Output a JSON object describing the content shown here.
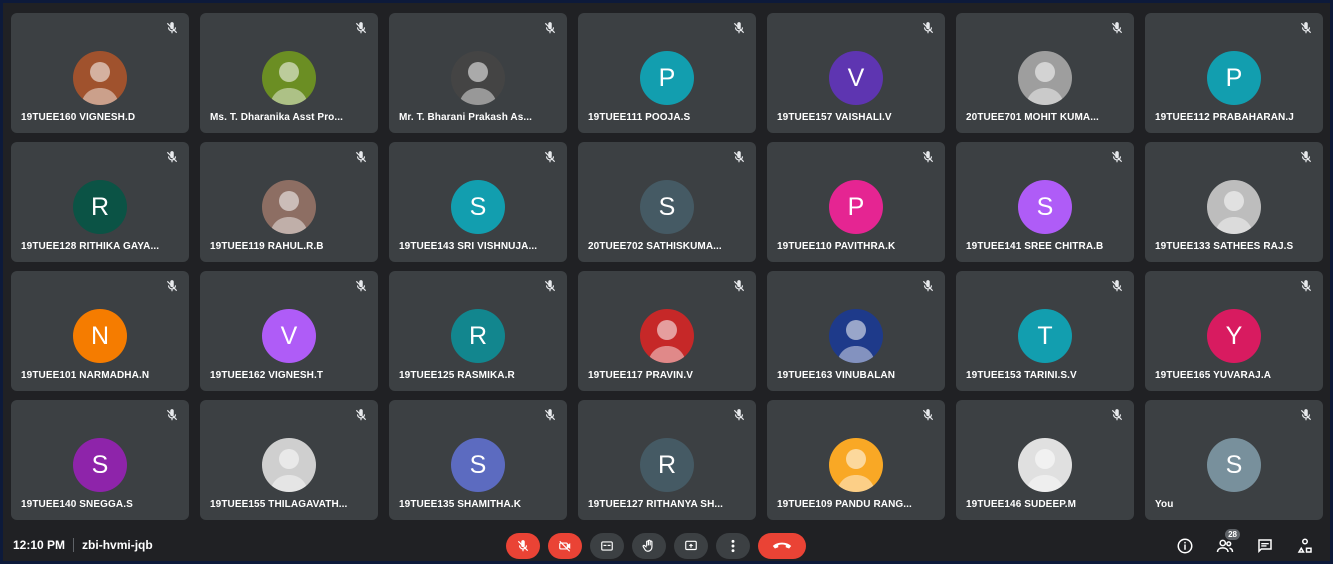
{
  "participants": [
    {
      "name": "19TUEE160 VIGNESH.D",
      "initial": "",
      "color": "#a0522d",
      "photo": true
    },
    {
      "name": "Ms. T. Dharanika Asst Pro...",
      "initial": "",
      "color": "#6b8e23",
      "photo": true
    },
    {
      "name": "Mr. T. Bharani Prakash As...",
      "initial": "",
      "color": "#444444",
      "photo": true
    },
    {
      "name": "19TUEE111 POOJA.S",
      "initial": "P",
      "color": "#129eaf",
      "photo": false
    },
    {
      "name": "19TUEE157 VAISHALI.V",
      "initial": "V",
      "color": "#5e35b1",
      "photo": false
    },
    {
      "name": "20TUEE701 MOHIT KUMA...",
      "initial": "",
      "color": "#9e9e9e",
      "photo": true
    },
    {
      "name": "19TUEE112 PRABAHARAN.J",
      "initial": "P",
      "color": "#129eaf",
      "photo": false
    },
    {
      "name": "19TUEE128 RITHIKA GAYA...",
      "initial": "R",
      "color": "#0b5345",
      "photo": false
    },
    {
      "name": "19TUEE119 RAHUL.R.B",
      "initial": "",
      "color": "#8d6e63",
      "photo": true
    },
    {
      "name": "19TUEE143 SRI VISHNUJA...",
      "initial": "S",
      "color": "#129eaf",
      "photo": false
    },
    {
      "name": "20TUEE702 SATHISKUMA...",
      "initial": "S",
      "color": "#455a64",
      "photo": false
    },
    {
      "name": "19TUEE110 PAVITHRA.K",
      "initial": "P",
      "color": "#e52592",
      "photo": false
    },
    {
      "name": "19TUEE141 SREE CHITRA.B",
      "initial": "S",
      "color": "#af5cf7",
      "photo": false
    },
    {
      "name": "19TUEE133 SATHEES RAJ.S",
      "initial": "",
      "color": "#bdbdbd",
      "photo": true
    },
    {
      "name": "19TUEE101 NARMADHA.N",
      "initial": "N",
      "color": "#f57c00",
      "photo": false
    },
    {
      "name": "19TUEE162 VIGNESH.T",
      "initial": "V",
      "color": "#af5cf7",
      "photo": false
    },
    {
      "name": "19TUEE125 RASMIKA.R",
      "initial": "R",
      "color": "#12868e",
      "photo": false
    },
    {
      "name": "19TUEE117 PRAVIN.V",
      "initial": "",
      "color": "#c62828",
      "photo": true
    },
    {
      "name": "19TUEE163 VINUBALAN",
      "initial": "",
      "color": "#1e3a8a",
      "photo": true
    },
    {
      "name": "19TUEE153 TARINI.S.V",
      "initial": "T",
      "color": "#129eaf",
      "photo": false
    },
    {
      "name": "19TUEE165 YUVARAJ.A",
      "initial": "Y",
      "color": "#d81b60",
      "photo": false
    },
    {
      "name": "19TUEE140 SNEGGA.S",
      "initial": "S",
      "color": "#8e24aa",
      "photo": false
    },
    {
      "name": "19TUEE155 THILAGAVATH...",
      "initial": "",
      "color": "#cfcfcf",
      "photo": true
    },
    {
      "name": "19TUEE135 SHAMITHA.K",
      "initial": "S",
      "color": "#5c6bc0",
      "photo": false
    },
    {
      "name": "19TUEE127 RITHANYA SH...",
      "initial": "R",
      "color": "#455a64",
      "photo": false
    },
    {
      "name": "19TUEE109 PANDU RANG...",
      "initial": "",
      "color": "#f9a825",
      "photo": true
    },
    {
      "name": "19TUEE146 SUDEEP.M",
      "initial": "",
      "color": "#e0e0e0",
      "photo": true
    },
    {
      "name": "You",
      "initial": "S",
      "color": "#78909c",
      "photo": false
    }
  ],
  "meeting": {
    "time": "12:10 PM",
    "code": "zbi-hvmi-jqb"
  },
  "people_count": "28",
  "icons": {
    "mute": "mic-off-icon",
    "camera": "camera-off-icon",
    "captions": "captions-icon",
    "hand": "raise-hand-icon",
    "present": "present-icon",
    "more": "more-options-icon",
    "end": "end-call-icon",
    "info": "info-icon",
    "people": "people-icon",
    "chat": "chat-icon",
    "activities": "activities-icon"
  }
}
